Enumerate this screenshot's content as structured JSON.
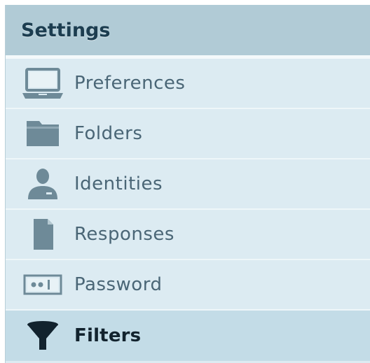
{
  "header": {
    "title": "Settings"
  },
  "menu": {
    "items": [
      {
        "label": "Preferences",
        "icon": "laptop-icon"
      },
      {
        "label": "Folders",
        "icon": "folder-icon"
      },
      {
        "label": "Identities",
        "icon": "person-icon"
      },
      {
        "label": "Responses",
        "icon": "document-icon"
      },
      {
        "label": "Password",
        "icon": "password-icon"
      },
      {
        "label": "Filters",
        "icon": "funnel-icon",
        "selected": true
      }
    ]
  },
  "colors": {
    "panel_bg": "#dcebf2",
    "header_bg": "#b1cbd6",
    "selected_bg": "#c3dce7",
    "icon": "#6e8a98",
    "selected_icon": "#12232e"
  }
}
